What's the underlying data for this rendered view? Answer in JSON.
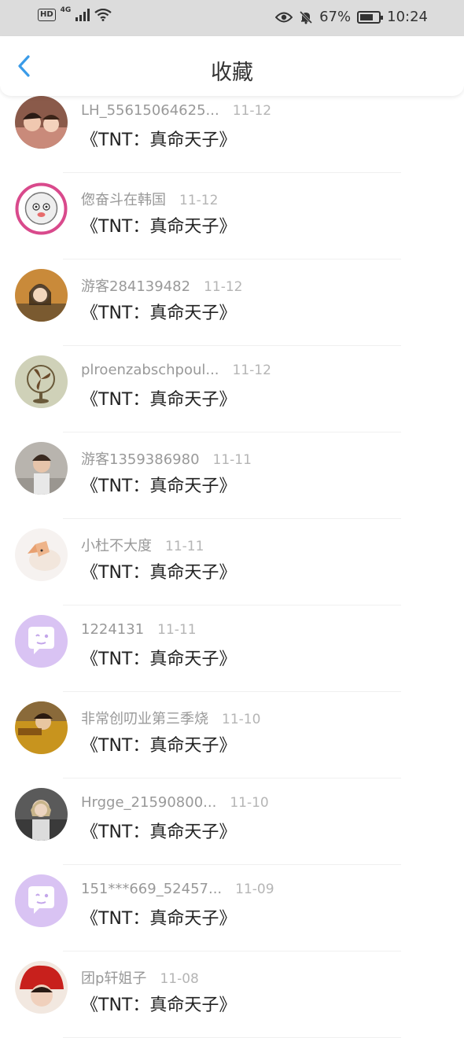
{
  "status_bar": {
    "hd": "HD",
    "network": "4G",
    "battery_pct": "67%",
    "time": "10:24"
  },
  "header": {
    "title": "收藏"
  },
  "items": [
    {
      "user": "LH_55615064625...",
      "date": "11-12",
      "book": "《TNT：真命天子》"
    },
    {
      "user": "偬奋斗在韩国",
      "date": "11-12",
      "book": "《TNT：真命天子》"
    },
    {
      "user": "游客284139482",
      "date": "11-12",
      "book": "《TNT：真命天子》"
    },
    {
      "user": "plroenzabschpoul...",
      "date": "11-12",
      "book": "《TNT：真命天子》"
    },
    {
      "user": "游客1359386980",
      "date": "11-11",
      "book": "《TNT：真命天子》"
    },
    {
      "user": "小杜不大度",
      "date": "11-11",
      "book": "《TNT：真命天子》"
    },
    {
      "user": "1224131",
      "date": "11-11",
      "book": "《TNT：真命天子》"
    },
    {
      "user": "非常创叨业第三季烧",
      "date": "11-10",
      "book": "《TNT：真命天子》"
    },
    {
      "user": "Hrgge_21590800...",
      "date": "11-10",
      "book": "《TNT：真命天子》"
    },
    {
      "user": "151***669_52457...",
      "date": "11-09",
      "book": "《TNT：真命天子》"
    },
    {
      "user": "团p轩姐子",
      "date": "11-08",
      "book": "《TNT：真命天子》"
    }
  ],
  "colors": {
    "accent": "#3a9be8",
    "default_avatar": "#d9c3f3"
  }
}
